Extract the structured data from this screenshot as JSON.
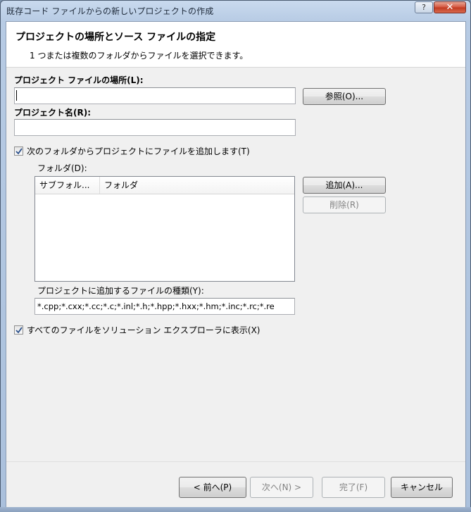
{
  "window": {
    "title": "既存コード ファイルからの新しいプロジェクトの作成",
    "help_glyph": "?",
    "close_glyph": "✕"
  },
  "header": {
    "title": "プロジェクトの場所とソース ファイルの指定",
    "subtitle": "1 つまたは複数のフォルダからファイルを選択できます。"
  },
  "project_location": {
    "label": "プロジェクト ファイルの場所(L):",
    "value": "",
    "browse_button": "参照(O)..."
  },
  "project_name": {
    "label": "プロジェクト名(R):",
    "value": ""
  },
  "add_from_folders": {
    "checked": true,
    "label": "次のフォルダからプロジェクトにファイルを追加します(T)"
  },
  "folders": {
    "label": "フォルダ(D):",
    "columns": [
      "サブフォル...",
      "フォルダ"
    ],
    "rows": [],
    "add_button": "追加(A)...",
    "remove_button": "削除(R)"
  },
  "file_types": {
    "label": "プロジェクトに追加するファイルの種類(Y):",
    "value": "*.cpp;*.cxx;*.cc;*.c;*.inl;*.h;*.hpp;*.hxx;*.hm;*.inc;*.rc;*.re"
  },
  "show_all": {
    "checked": true,
    "label": "すべてのファイルをソリューション エクスプローラに表示(X)"
  },
  "buttons": {
    "back": "< 前へ(P)",
    "next": "次へ(N) >",
    "finish": "完了(F)",
    "cancel": "キャンセル"
  },
  "colors": {
    "title_bar": "#b7cbe4",
    "close_button": "#c0391f",
    "dialog_background": "#f0f0f0"
  }
}
